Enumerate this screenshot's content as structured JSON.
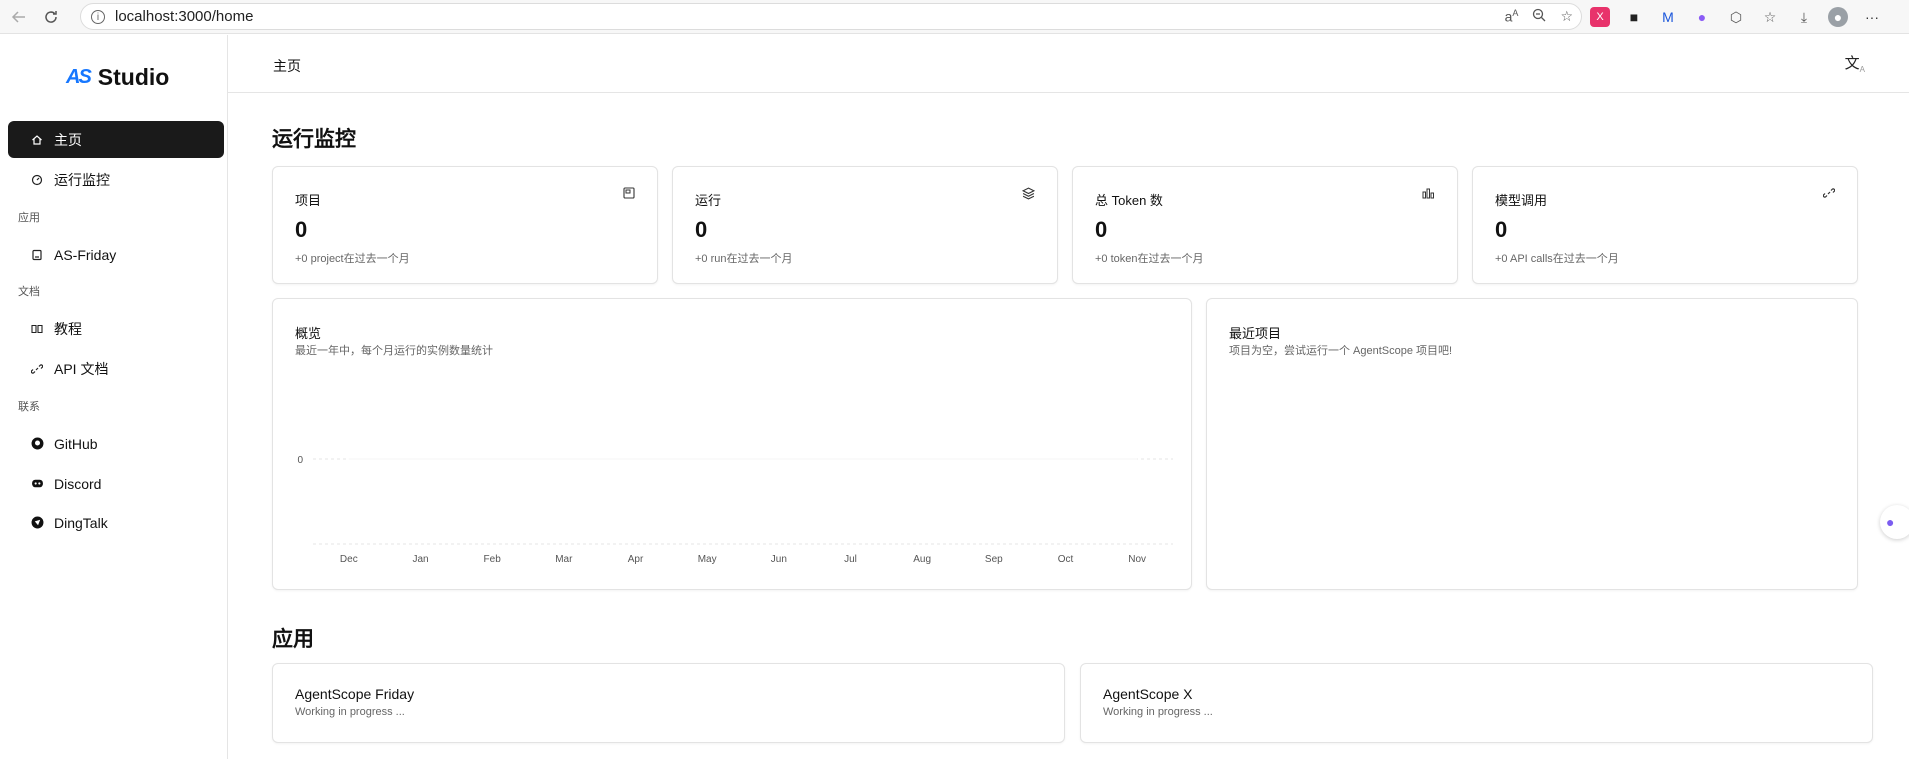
{
  "browser": {
    "url": "localhost:3000/home",
    "icons": [
      "back-icon",
      "reload-icon",
      "info-icon",
      "read-aloud-icon",
      "zoom-icon",
      "favorite-icon",
      "extensions-icon",
      "collections-icon",
      "downloads-icon",
      "profile-icon",
      "more-icon"
    ],
    "more_label": "···"
  },
  "sidebar": {
    "brand_mark": "AS",
    "brand_name": "Studio",
    "items": [
      {
        "label": "主页",
        "icon": "home-icon",
        "active": true
      },
      {
        "label": "运行监控",
        "icon": "gauge-icon",
        "active": false
      }
    ],
    "groups": [
      {
        "title": "应用",
        "items": [
          {
            "label": "AS-Friday",
            "icon": "app-icon"
          }
        ]
      },
      {
        "title": "文档",
        "items": [
          {
            "label": "教程",
            "icon": "book-icon"
          },
          {
            "label": "API 文档",
            "icon": "link-icon"
          }
        ]
      },
      {
        "title": "联系",
        "items": [
          {
            "label": "GitHub",
            "icon": "github-icon"
          },
          {
            "label": "Discord",
            "icon": "discord-icon"
          },
          {
            "label": "DingTalk",
            "icon": "dingtalk-icon"
          }
        ]
      }
    ]
  },
  "header": {
    "breadcrumb": "主页",
    "lang_glyph": "文"
  },
  "monitor": {
    "title": "运行监控",
    "stats": [
      {
        "title": "项目",
        "value": "0",
        "sub": "+0 project在过去一个月",
        "icon": "project-icon"
      },
      {
        "title": "运行",
        "value": "0",
        "sub": "+0 run在过去一个月",
        "icon": "layers-icon"
      },
      {
        "title": "总 Token 数",
        "value": "0",
        "sub": "+0 token在过去一个月",
        "icon": "bar-chart-icon"
      },
      {
        "title": "模型调用",
        "value": "0",
        "sub": "+0 API calls在过去一个月",
        "icon": "link-icon"
      }
    ],
    "overview": {
      "title": "概览",
      "subtitle": "最近一年中，每个月运行的实例数量统计"
    },
    "recent": {
      "title": "最近项目",
      "empty_text": "项目为空，尝试运行一个 AgentScope 项目吧!"
    }
  },
  "chart_data": {
    "type": "line",
    "categories": [
      "Dec",
      "Jan",
      "Feb",
      "Mar",
      "Apr",
      "May",
      "Jun",
      "Jul",
      "Aug",
      "Sep",
      "Oct",
      "Nov"
    ],
    "values": [
      0,
      0,
      0,
      0,
      0,
      0,
      0,
      0,
      0,
      0,
      0,
      0
    ],
    "y_ticks": [
      "0"
    ],
    "title": "",
    "xlabel": "",
    "ylabel": "",
    "grid": true
  },
  "apps": {
    "title": "应用",
    "items": [
      {
        "title": "AgentScope Friday",
        "sub": "Working in progress ..."
      },
      {
        "title": "AgentScope X",
        "sub": "Working in progress ..."
      }
    ]
  },
  "colors": {
    "active_bg": "#1a1a1a",
    "brand_blue": "#1677ff",
    "border": "#e3e3e3"
  }
}
